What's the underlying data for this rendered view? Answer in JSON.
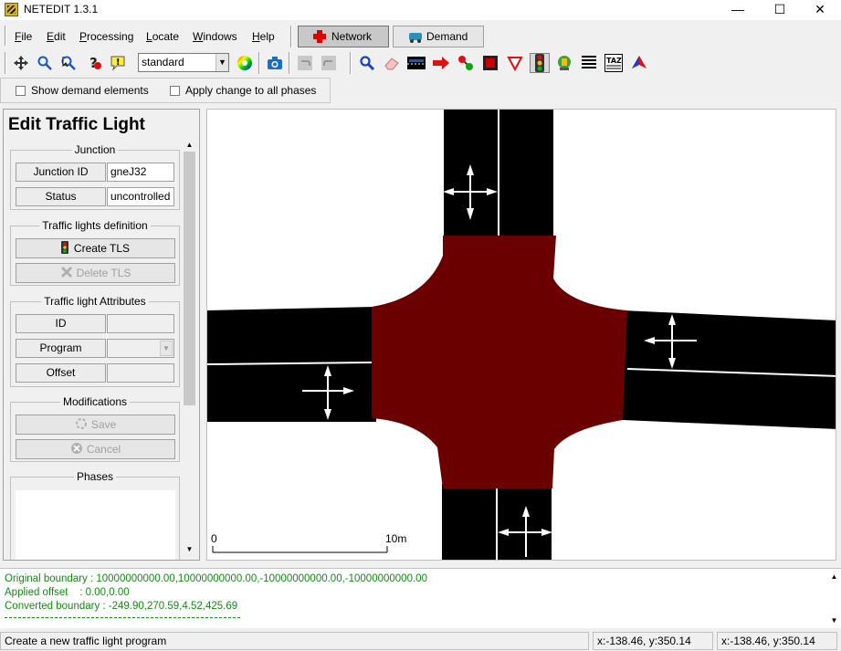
{
  "window": {
    "title": "NETEDIT 1.3.1",
    "controls": [
      "—",
      "☐",
      "✕"
    ]
  },
  "menu": {
    "items": [
      "File",
      "Edit",
      "Processing",
      "Locate",
      "Windows",
      "Help"
    ],
    "mnemonics": [
      "F",
      "E",
      "P",
      "L",
      "W",
      "H"
    ],
    "rest": [
      "ile",
      "dit",
      "rocessing",
      "ocate",
      "indows",
      "elp"
    ]
  },
  "modes": {
    "network": "Network",
    "demand": "Demand"
  },
  "toolbar": {
    "view_scheme": "standard"
  },
  "options": {
    "show_demand": "Show demand elements",
    "apply_all_phases": "Apply change to all phases"
  },
  "panel": {
    "title": "Edit Traffic Light",
    "junction": {
      "group_title": "Junction",
      "id_label": "Junction ID",
      "id_value": "gneJ32",
      "status_label": "Status",
      "status_value": "uncontrolled"
    },
    "tls_def": {
      "group_title": "Traffic lights definition",
      "create": "Create TLS",
      "delete": "Delete TLS"
    },
    "tls_attr": {
      "group_title": "Traffic light Attributes",
      "id_label": "ID",
      "program_label": "Program",
      "offset_label": "Offset"
    },
    "modifications": {
      "group_title": "Modifications",
      "save": "Save",
      "cancel": "Cancel"
    },
    "phases": {
      "group_title": "Phases"
    }
  },
  "canvas": {
    "scale_start": "0",
    "scale_end": "10m",
    "junction_color": "#6b0000",
    "road_color": "#000000"
  },
  "console": {
    "line1": "Original boundary : 10000000000.00,10000000000.00,-10000000000.00,-10000000000.00",
    "line2": "Applied offset    : 0.00,0.00",
    "line3": "Converted boundary : -249.90,270.59,4.52,425.69"
  },
  "status": {
    "message": "Create a new traffic light program",
    "coords1": "x:-138.46, y:350.14",
    "coords2": "x:-138.46, y:350.14"
  }
}
